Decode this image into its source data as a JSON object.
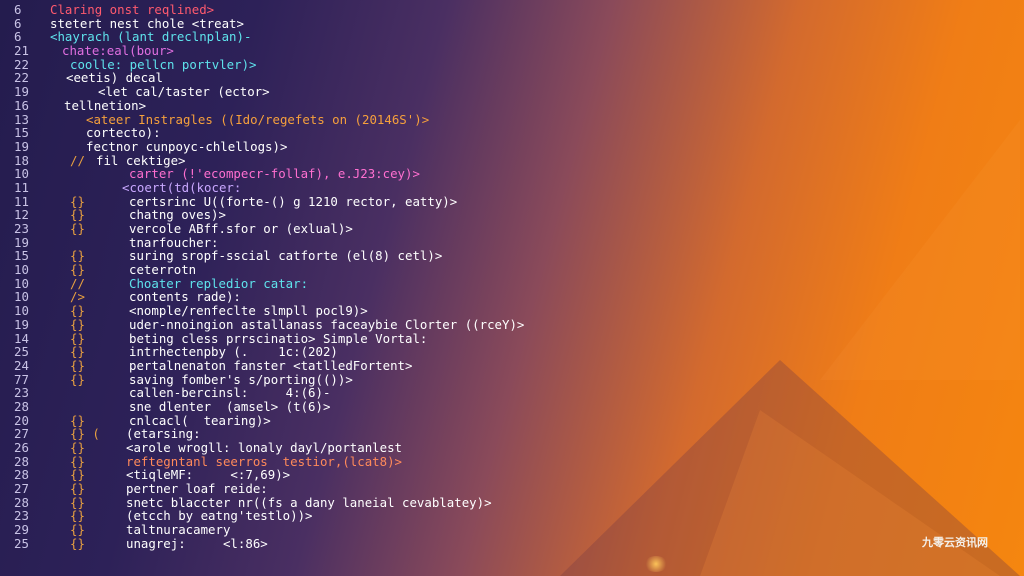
{
  "editor": {
    "lines": [
      {
        "num": "6",
        "gutter": "",
        "indent": 36,
        "text": "Claring onst reqlined>",
        "color": "#ff5a6e"
      },
      {
        "num": "6",
        "gutter": "",
        "indent": 36,
        "text": "stetert nest chole <treat>",
        "color": "#ffffff"
      },
      {
        "num": "6",
        "gutter": "",
        "indent": 36,
        "text": "<hayrach (lant dreclnplan)-",
        "color": "#5fe3ec"
      },
      {
        "num": "21",
        "gutter": "",
        "indent": 48,
        "text": "chate:eal(bour>",
        "color": "#e06fe0"
      },
      {
        "num": "22",
        "gutter": "",
        "indent": 56,
        "text": "coolle: pellcn portvler)>",
        "color": "#5fe3ec"
      },
      {
        "num": "22",
        "gutter": "",
        "indent": 52,
        "text": "<eetis) decal",
        "color": "#ffffff"
      },
      {
        "num": "19",
        "gutter": "",
        "indent": 84,
        "text": "<let cal/taster (ector>",
        "color": "#ffffff"
      },
      {
        "num": "16",
        "gutter": "",
        "indent": 50,
        "text": "tellnetion>",
        "color": "#ffffff"
      },
      {
        "num": "13",
        "gutter": "",
        "indent": 72,
        "text": "<ateer Instragles ((Ido/regefets on (20146S')>",
        "color": "#f6a03c"
      },
      {
        "num": "15",
        "gutter": "",
        "indent": 72,
        "text": "cortecto):",
        "color": "#ffffff"
      },
      {
        "num": "19",
        "gutter": "",
        "indent": 72,
        "text": "fectnor cunpoyc-chlellogs)>",
        "color": "#ffffff"
      },
      {
        "num": "18",
        "gutter": "//",
        "indent": 82,
        "text": "fil cektige>",
        "color": "#ffffff"
      },
      {
        "num": "10",
        "gutter": "",
        "indent": 115,
        "text": "carter (!'ecompecr-follaf), e.J23:cey)>",
        "color": "#ff6fd0"
      },
      {
        "num": "11",
        "gutter": "",
        "indent": 108,
        "text": "<coert(td(kocer:",
        "color": "#c9a8ff"
      },
      {
        "num": "11",
        "gutter": "{}",
        "indent": 115,
        "text": "certsrinc U((forte-() g 1210 rector, eatty)>",
        "color": "#ffffff"
      },
      {
        "num": "12",
        "gutter": "{}",
        "indent": 115,
        "text": "chatng oves)>",
        "color": "#ffffff"
      },
      {
        "num": "23",
        "gutter": "{}",
        "indent": 115,
        "text": "vercole ABff.sfor or (exlual)>",
        "color": "#ffffff"
      },
      {
        "num": "19",
        "gutter": "",
        "indent": 115,
        "text": "tnarfoucher:",
        "color": "#ffffff"
      },
      {
        "num": "15",
        "gutter": "{}",
        "indent": 115,
        "text": "suring sropf-sscial catforte (el(8) cetl)>",
        "color": "#ffffff"
      },
      {
        "num": "10",
        "gutter": "{}",
        "indent": 115,
        "text": "ceterrotn",
        "color": "#ffffff"
      },
      {
        "num": "10",
        "gutter": "//",
        "indent": 115,
        "text": "Choater repledior catar:",
        "color": "#5fe3ec"
      },
      {
        "num": "10",
        "gutter": "/>",
        "indent": 115,
        "text": "contents rade):",
        "color": "#ffffff"
      },
      {
        "num": "10",
        "gutter": "{}",
        "indent": 115,
        "text": "<nomple/renfeclte slmpll pocl9)>",
        "color": "#ffffff"
      },
      {
        "num": "19",
        "gutter": "{}",
        "indent": 115,
        "text": "uder-nnoingion astallanass faceaybie Clorter ((rceY)>",
        "color": "#ffffff"
      },
      {
        "num": "14",
        "gutter": "{}",
        "indent": 115,
        "text": "beting cless prrscinatio> Simple Vortal:",
        "color": "#ffffff"
      },
      {
        "num": "25",
        "gutter": "{}",
        "indent": 115,
        "text": "intrhectenpby (.    1c:(202)",
        "color": "#ffffff"
      },
      {
        "num": "24",
        "gutter": "{}",
        "indent": 115,
        "text": "pertalnenaton fanster <tatlledFortent>",
        "color": "#ffffff"
      },
      {
        "num": "77",
        "gutter": "{}",
        "indent": 115,
        "text": "saving fomber's s/porting(())>",
        "color": "#ffffff"
      },
      {
        "num": "23",
        "gutter": "",
        "indent": 115,
        "text": "callen-bercinsl:     4:(6)-",
        "color": "#ffffff"
      },
      {
        "num": "28",
        "gutter": "",
        "indent": 115,
        "text": "sne dlenter  (amsel> (t(6)>",
        "color": "#ffffff"
      },
      {
        "num": "20",
        "gutter": "{}",
        "indent": 115,
        "text": "cnlcacl(  tearing)>",
        "color": "#ffffff"
      },
      {
        "num": "27",
        "gutter": "{} (",
        "indent": 112,
        "text": "(etarsing:",
        "color": "#ffffff"
      },
      {
        "num": "26",
        "gutter": "{}",
        "indent": 112,
        "text": "<arole wrogll: lonaly dayl/portanlest",
        "color": "#ffffff"
      },
      {
        "num": "28",
        "gutter": "{}",
        "indent": 112,
        "text": "reftegntanl seerros  testior,(lcat8)>",
        "color": "#ff8a5a"
      },
      {
        "num": "28",
        "gutter": "{}",
        "indent": 112,
        "text": "<tiqleMF:     <:7,69)>",
        "color": "#ffffff"
      },
      {
        "num": "27",
        "gutter": "{}",
        "indent": 112,
        "text": "pertner loaf reide:",
        "color": "#ffffff"
      },
      {
        "num": "28",
        "gutter": "{}",
        "indent": 112,
        "text": "snetc blaccter nr((fs a dany laneial cevablatey)>",
        "color": "#ffffff"
      },
      {
        "num": "23",
        "gutter": "{}",
        "indent": 112,
        "text": "(etcch by eatng'testlo))>",
        "color": "#ffffff"
      },
      {
        "num": "29",
        "gutter": "{}",
        "indent": 112,
        "text": "taltnuracamery",
        "color": "#ffffff"
      },
      {
        "num": "25",
        "gutter": "{}",
        "indent": 112,
        "text": "unagrej:     <l:86>",
        "color": "#ffffff"
      }
    ]
  },
  "watermark": {
    "text": "九零云资讯网"
  }
}
